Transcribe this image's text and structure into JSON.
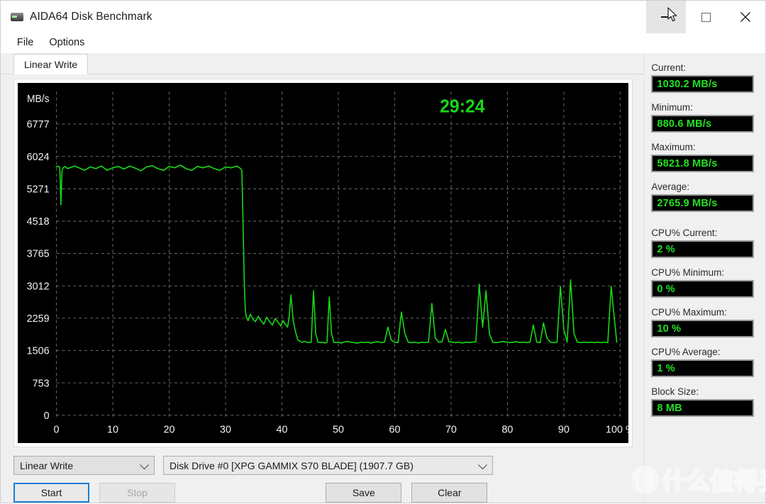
{
  "window": {
    "title": "AIDA64 Disk Benchmark",
    "icon": "disk-icon",
    "controls": {
      "minimize": "minimize-icon",
      "maximize": "maximize-icon",
      "close": "close-icon"
    }
  },
  "menubar": {
    "items": [
      {
        "label": "File"
      },
      {
        "label": "Options"
      }
    ]
  },
  "tabs": [
    {
      "label": "Linear Write",
      "active": true
    }
  ],
  "chart": {
    "timer": "29:24",
    "line_color": "#18d818",
    "background": "#000000",
    "grid_color": "#8a8a8a"
  },
  "chart_data": {
    "type": "line",
    "title": "",
    "xlabel": "100 %",
    "ylabel": "MB/s",
    "xlim": [
      0,
      100
    ],
    "ylim": [
      0,
      7530
    ],
    "grid": true,
    "legend": false,
    "yticks": [
      0,
      753,
      1506,
      2259,
      3012,
      3765,
      4518,
      5271,
      6024,
      6777
    ],
    "ytick_labels": [
      "0",
      "753",
      "1506",
      "2259",
      "3012",
      "3765",
      "4518",
      "5271",
      "6024",
      "6777"
    ],
    "y_axis_unit": "MB/s",
    "xticks": [
      0,
      10,
      20,
      30,
      40,
      50,
      60,
      70,
      80,
      90,
      100
    ],
    "xtick_labels": [
      "0",
      "10",
      "20",
      "30",
      "40",
      "50",
      "60",
      "70",
      "80",
      "90",
      "100 %"
    ],
    "annotations": [
      {
        "text": "29:24",
        "x": 72,
        "y": 7050,
        "color": "#18d818"
      }
    ],
    "series": [
      {
        "name": "Linear Write",
        "color": "#18d818",
        "x": [
          0.0,
          0.3,
          0.6,
          0.8,
          1.0,
          1.2,
          1.5,
          2.0,
          2.6,
          3.2,
          4.0,
          5.0,
          6.0,
          7.0,
          8.0,
          9.0,
          10.0,
          11.0,
          12.0,
          13.0,
          14.0,
          15.0,
          16.0,
          17.0,
          18.0,
          19.0,
          20.0,
          21.0,
          22.0,
          23.0,
          24.0,
          25.0,
          26.0,
          27.0,
          28.0,
          29.0,
          30.0,
          31.0,
          32.0,
          32.6,
          32.9,
          33.1,
          33.3,
          33.5,
          33.7,
          34.0,
          34.4,
          34.8,
          35.3,
          35.8,
          36.3,
          36.8,
          37.3,
          37.8,
          38.3,
          38.8,
          39.3,
          39.8,
          40.2,
          40.6,
          41.0,
          41.3,
          41.6,
          42.0,
          42.4,
          42.8,
          43.2,
          43.6,
          44.0,
          44.4,
          44.8,
          45.2,
          45.6,
          46.0,
          46.4,
          46.8,
          47.2,
          47.6,
          48.0,
          48.4,
          48.8,
          49.2,
          49.6,
          50.0,
          50.5,
          51.0,
          51.6,
          52.2,
          52.8,
          53.4,
          54.0,
          54.6,
          55.2,
          55.8,
          56.4,
          57.0,
          57.6,
          58.2,
          58.8,
          59.4,
          60.0,
          60.6,
          61.2,
          61.8,
          62.4,
          63.0,
          63.6,
          64.2,
          64.8,
          65.4,
          66.0,
          66.6,
          67.2,
          67.8,
          68.4,
          69.0,
          69.6,
          70.2,
          70.8,
          71.4,
          72.0,
          72.6,
          73.2,
          73.8,
          74.4,
          75.0,
          75.6,
          76.2,
          76.8,
          77.4,
          78.0,
          78.6,
          79.2,
          79.8,
          80.4,
          81.0,
          81.6,
          82.2,
          82.8,
          83.4,
          84.0,
          84.6,
          85.2,
          85.8,
          86.4,
          87.0,
          87.6,
          88.2,
          88.8,
          89.4,
          90.0,
          90.6,
          91.2,
          91.8,
          92.4,
          93.0,
          93.6,
          94.2,
          94.8,
          95.4,
          96.0,
          96.6,
          97.2,
          97.8,
          98.4,
          99.0,
          99.4,
          99.8,
          100.0
        ],
        "y": [
          5780,
          5800,
          5760,
          4900,
          5700,
          5760,
          5790,
          5740,
          5770,
          5800,
          5760,
          5700,
          5780,
          5740,
          5800,
          5700,
          5760,
          5790,
          5730,
          5800,
          5750,
          5690,
          5780,
          5810,
          5740,
          5700,
          5790,
          5760,
          5820,
          5740,
          5700,
          5790,
          5760,
          5800,
          5740,
          5700,
          5780,
          5760,
          5800,
          5750,
          5700,
          4500,
          3200,
          2450,
          2280,
          2200,
          2350,
          2250,
          2180,
          2300,
          2200,
          2120,
          2280,
          2180,
          2100,
          2250,
          2170,
          2080,
          2200,
          2120,
          2050,
          2300,
          2800,
          2200,
          1950,
          1760,
          1720,
          1700,
          1720,
          1700,
          1690,
          1700,
          2900,
          1900,
          1700,
          1690,
          1700,
          1680,
          1700,
          2750,
          1900,
          1700,
          1690,
          1700,
          1680,
          1700,
          1720,
          1700,
          1690,
          1680,
          1700,
          1690,
          1700,
          1680,
          1700,
          1710,
          1690,
          1700,
          2050,
          1750,
          1700,
          1690,
          2400,
          1900,
          1700,
          1690,
          1700,
          1680,
          1700,
          1690,
          1700,
          2600,
          1800,
          1700,
          1710,
          2000,
          1720,
          1700,
          1690,
          1700,
          1680,
          1700,
          1690,
          1700,
          1710,
          3050,
          2050,
          2900,
          1900,
          1700,
          1690,
          1700,
          1720,
          1700,
          1690,
          1700,
          1710,
          1690,
          1700,
          1690,
          1700,
          2100,
          1700,
          1690,
          2150,
          1800,
          1700,
          1690,
          1700,
          3000,
          2000,
          1700,
          3150,
          1900,
          1700,
          1690,
          1700,
          1690,
          1700,
          1690,
          1700,
          1690,
          1700,
          1690,
          3000,
          2200,
          1700
        ]
      }
    ]
  },
  "stats": [
    {
      "label": "Current:",
      "value": "1030.2 MB/s"
    },
    {
      "label": "Minimum:",
      "value": "880.6 MB/s"
    },
    {
      "label": "Maximum:",
      "value": "5821.8 MB/s"
    },
    {
      "label": "Average:",
      "value": "2765.9 MB/s"
    },
    {
      "label": "CPU% Current:",
      "value": "2 %"
    },
    {
      "label": "CPU% Minimum:",
      "value": "0 %"
    },
    {
      "label": "CPU% Maximum:",
      "value": "10 %"
    },
    {
      "label": "CPU% Average:",
      "value": "1 %"
    },
    {
      "label": "Block Size:",
      "value": "8 MB"
    }
  ],
  "controls": {
    "mode_select": {
      "value": "Linear Write"
    },
    "drive_select": {
      "value": "Disk Drive #0  [XPG GAMMIX S70 BLADE]  (1907.7 GB)"
    },
    "start_label": "Start",
    "stop_label": "Stop",
    "save_label": "Save",
    "clear_label": "Clear"
  },
  "watermark": {
    "text": "什么值得买",
    "badge": "值"
  }
}
